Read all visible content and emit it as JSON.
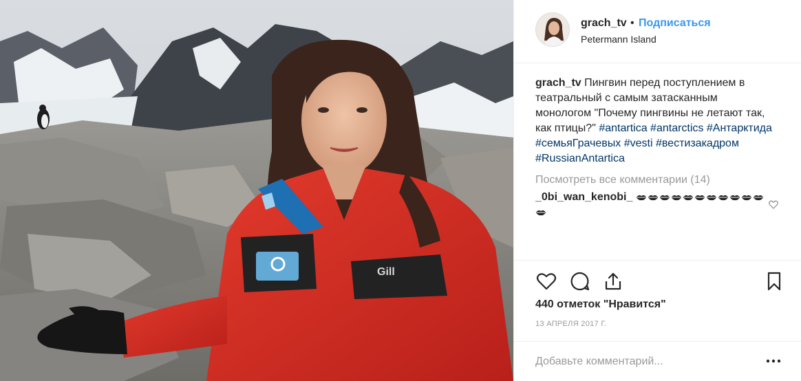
{
  "post": {
    "image_alt": "Woman in red Gill jacket in Antarctica with penguin on rocks",
    "jacket_brand": "Gill"
  },
  "header": {
    "username": "grach_tv",
    "separator": "•",
    "follow_label": "Подписаться",
    "location": "Petermann Island"
  },
  "caption": {
    "username": "grach_tv",
    "text": "Пингвин перед поступлением в театральный с самым затасканным монологом \"Почему пингвины не летают так, как птицы?\"",
    "hashtags": [
      "#antartica",
      "#antarctics",
      "#Антарктида",
      "#семьяГрачевых",
      "#vesti",
      "#вестизакадром",
      "#RussianAntartica"
    ]
  },
  "comments": {
    "view_all_label": "Посмотреть все комментарии (14)",
    "items": [
      {
        "username": "_0bi_wan_kenobi_",
        "emoji": "💋💋💋💋💋💋💋💋💋💋💋💋"
      }
    ]
  },
  "actions": {
    "icons": [
      "heart-icon",
      "comment-icon",
      "share-icon",
      "bookmark-icon"
    ],
    "likes_label": "440 отметок \"Нравится\"",
    "date": "13 АПРЕЛЯ 2017 Г."
  },
  "add_comment": {
    "placeholder": "Добавьте комментарий...",
    "more_icon": "more-options-icon"
  },
  "colors": {
    "accent": "#3897f0",
    "hashtag": "#003569",
    "muted": "#999999",
    "jacket": "#d42b22"
  }
}
